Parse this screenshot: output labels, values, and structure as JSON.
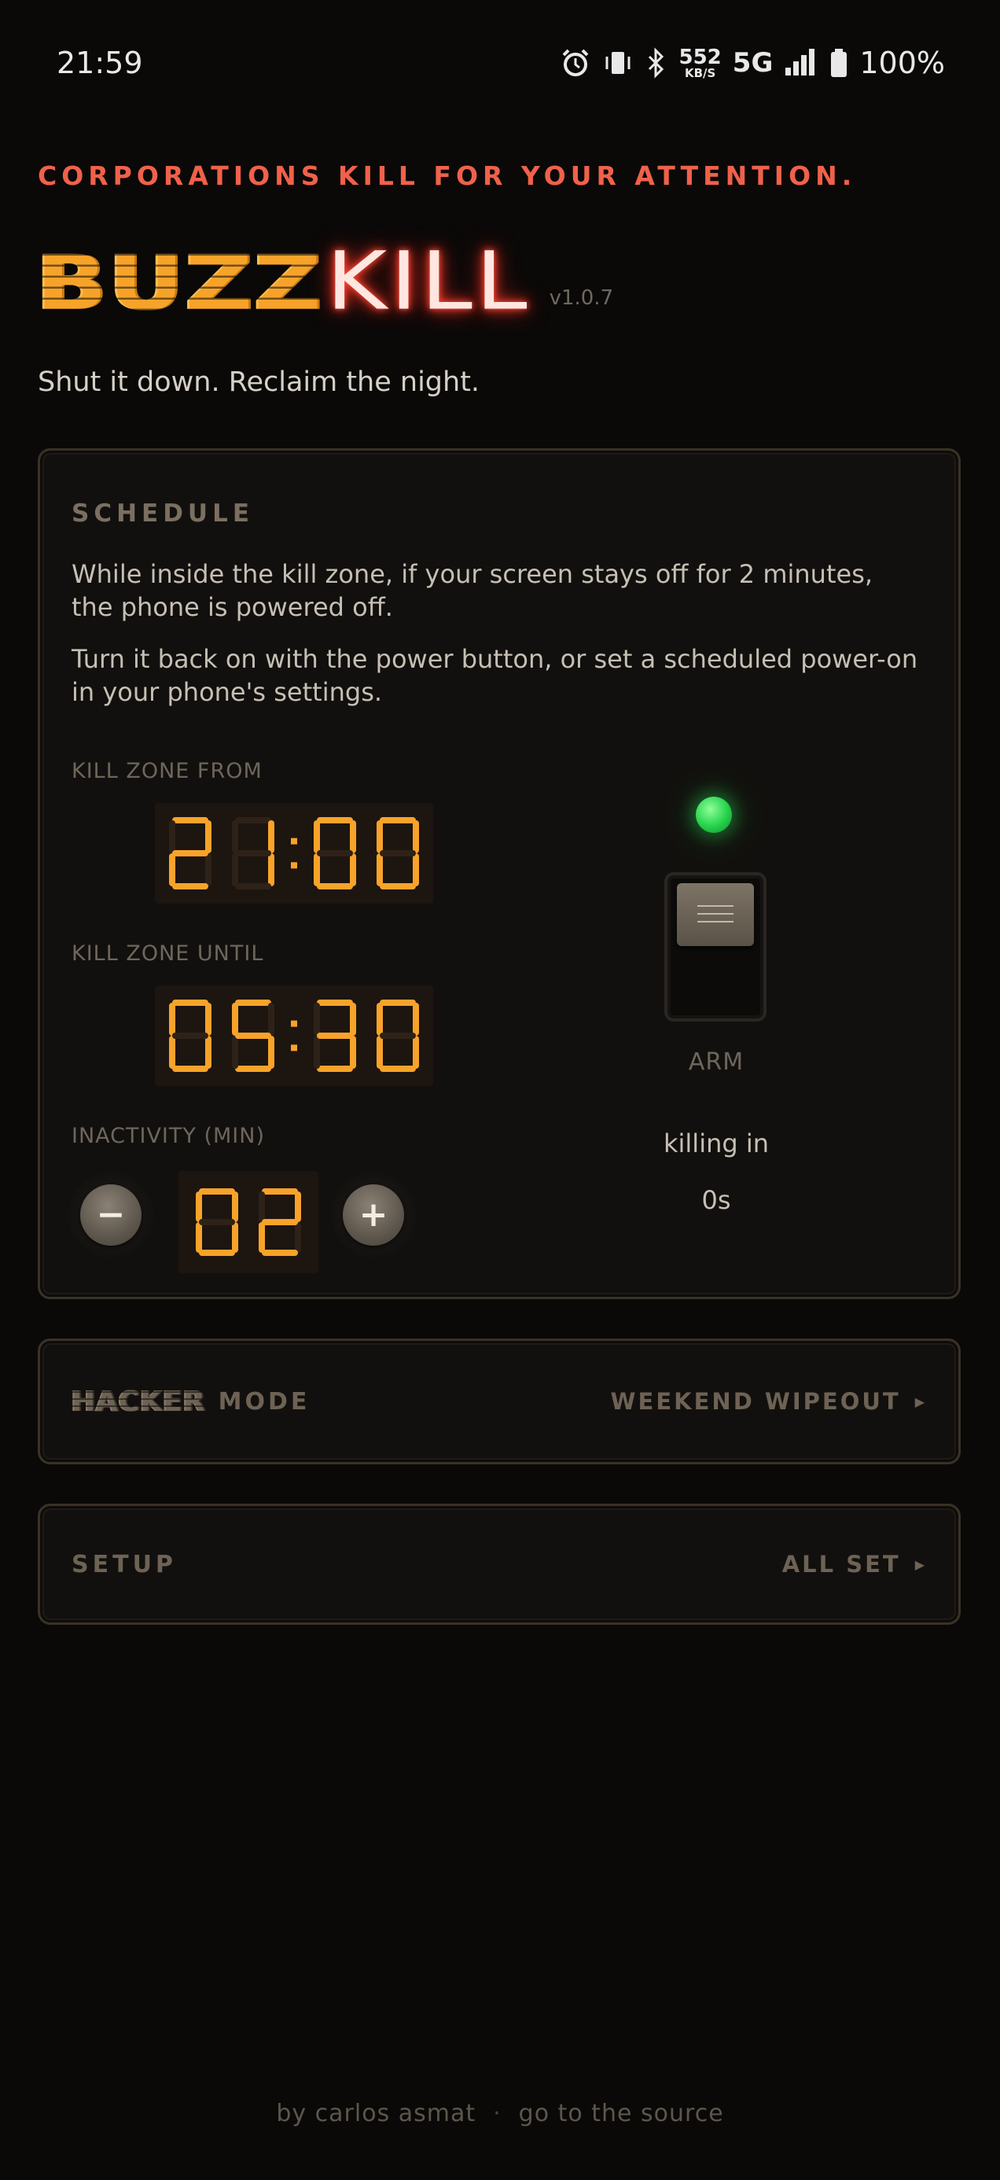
{
  "status_bar": {
    "time": "21:59",
    "net_speed": "552",
    "net_unit": "KB/S",
    "network": "5G",
    "battery": "100%",
    "icons": [
      "alarm-icon",
      "vibrate-icon",
      "bluetooth-icon",
      "signal-icon",
      "battery-icon"
    ]
  },
  "header": {
    "tagline": "CORPORATIONS KILL FOR YOUR ATTENTION.",
    "logo_part1": "BUZZ",
    "logo_part2": "KILL",
    "version": "v1.0.7",
    "subtitle": "Shut it down. Reclaim the night."
  },
  "schedule": {
    "title": "SCHEDULE",
    "description_1": "While inside the kill zone, if your screen stays off for 2 minutes, the phone is powered off.",
    "description_2": "Turn it back on with the power button, or set a scheduled power-on in your phone's settings.",
    "from_label": "KILL ZONE FROM",
    "from_value": "21:00",
    "until_label": "KILL ZONE UNTIL",
    "until_value": "05:30",
    "inactivity_label": "INACTIVITY (MIN)",
    "inactivity_value": "02",
    "minus_label": "−",
    "plus_label": "+",
    "arm_label": "ARM",
    "armed": true,
    "killing_label": "killing in",
    "killing_value": "0s"
  },
  "hacker_mode": {
    "word": "HACKER",
    "mode": "MODE",
    "action": "WEEKEND WIPEOUT"
  },
  "setup": {
    "label": "SETUP",
    "status": "ALL SET"
  },
  "footer": {
    "author": "by carlos asmat",
    "separator": "·",
    "source_link": "go to the source"
  },
  "colors": {
    "accent": "#f7a32a",
    "tagline": "#f0614a",
    "neon": "#ff4b3a",
    "led": "#24d14a",
    "segment_on": "#f7a32a",
    "segment_off": "#2e2218"
  }
}
